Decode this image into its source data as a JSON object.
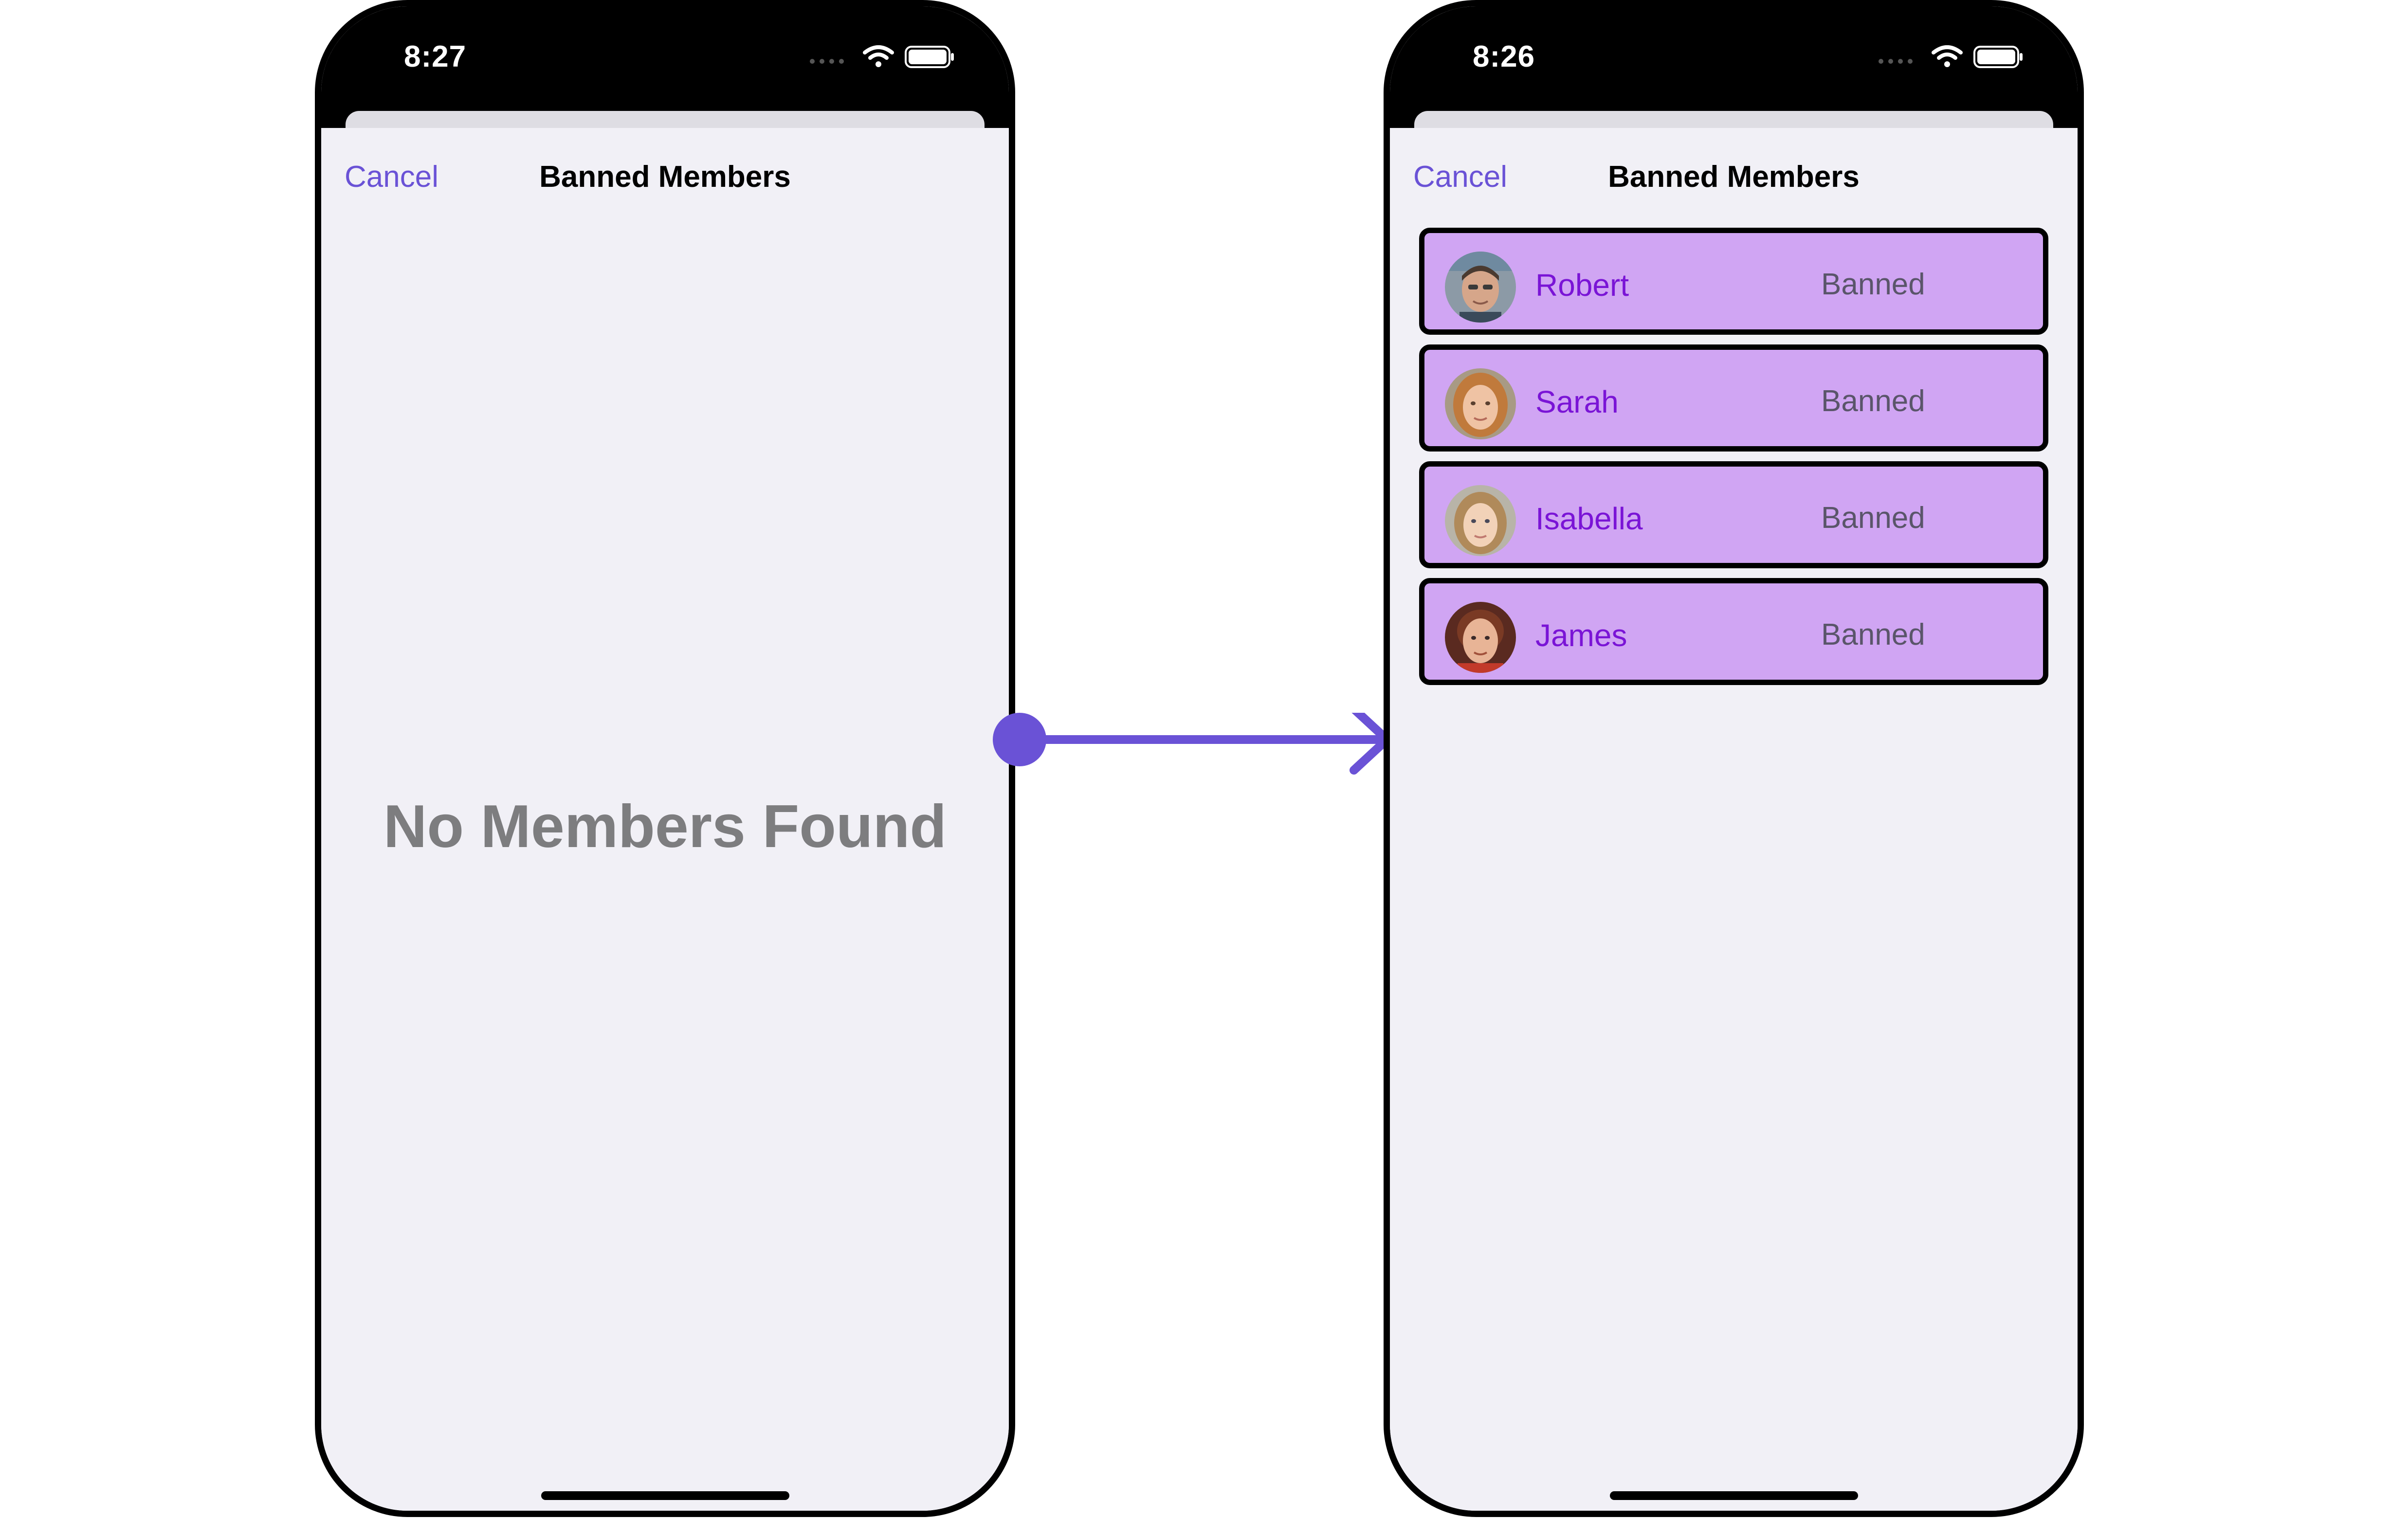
{
  "colors": {
    "accent": "#6a52d6",
    "row_background": "#d0a5f3",
    "member_name": "#7a14d6",
    "screen_background": "#f1f0f6"
  },
  "left_screen": {
    "status_time": "8:27",
    "nav": {
      "cancel_label": "Cancel",
      "title": "Banned Members"
    },
    "empty_message": "No Members Found"
  },
  "right_screen": {
    "status_time": "8:26",
    "nav": {
      "cancel_label": "Cancel",
      "title": "Banned Members"
    },
    "members": [
      {
        "name": "Robert",
        "status": "Banned",
        "avatar": "robert-avatar"
      },
      {
        "name": "Sarah",
        "status": "Banned",
        "avatar": "sarah-avatar"
      },
      {
        "name": "Isabella",
        "status": "Banned",
        "avatar": "isabella-avatar"
      },
      {
        "name": "James",
        "status": "Banned",
        "avatar": "james-avatar"
      }
    ]
  },
  "icons": [
    "cellular-signal-icon",
    "wifi-icon",
    "battery-icon",
    "transition-arrow-icon"
  ]
}
